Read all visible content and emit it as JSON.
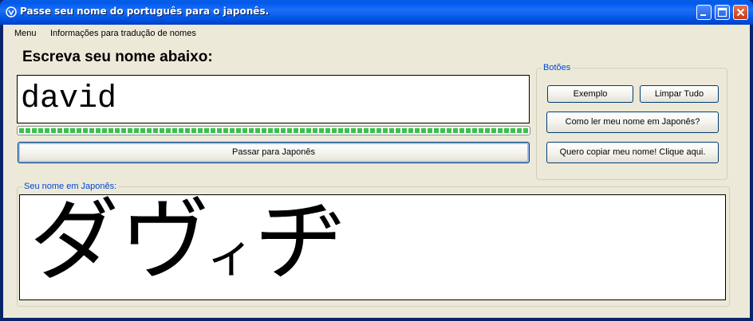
{
  "window": {
    "title": "Passe seu nome do português para o japonês.",
    "icon": "app-icon"
  },
  "menu": {
    "items": [
      "Menu",
      "Informações para tradução de nomes"
    ]
  },
  "input_section": {
    "heading": "Escreva seu nome abaixo:",
    "name_value": "david",
    "progress_percent": 100,
    "convert_button": "Passar para Japonês"
  },
  "buttons_group": {
    "label": "Botões",
    "example": "Exemplo",
    "clear_all": "Limpar Tudo",
    "how_to_read": "Como ler meu nome em Japonês?",
    "copy_name": "Quero copiar meu nome! Clique aqui."
  },
  "output_section": {
    "label": "Seu nome em Japonês:",
    "katakana_main_1": "ダヴ",
    "katakana_small": "ィ",
    "katakana_main_2": "ヂ"
  },
  "colors": {
    "titlebar": "#0058ee",
    "window_bg": "#ece9d8",
    "group_label": "#0046d5",
    "progress": "#39c24a"
  }
}
